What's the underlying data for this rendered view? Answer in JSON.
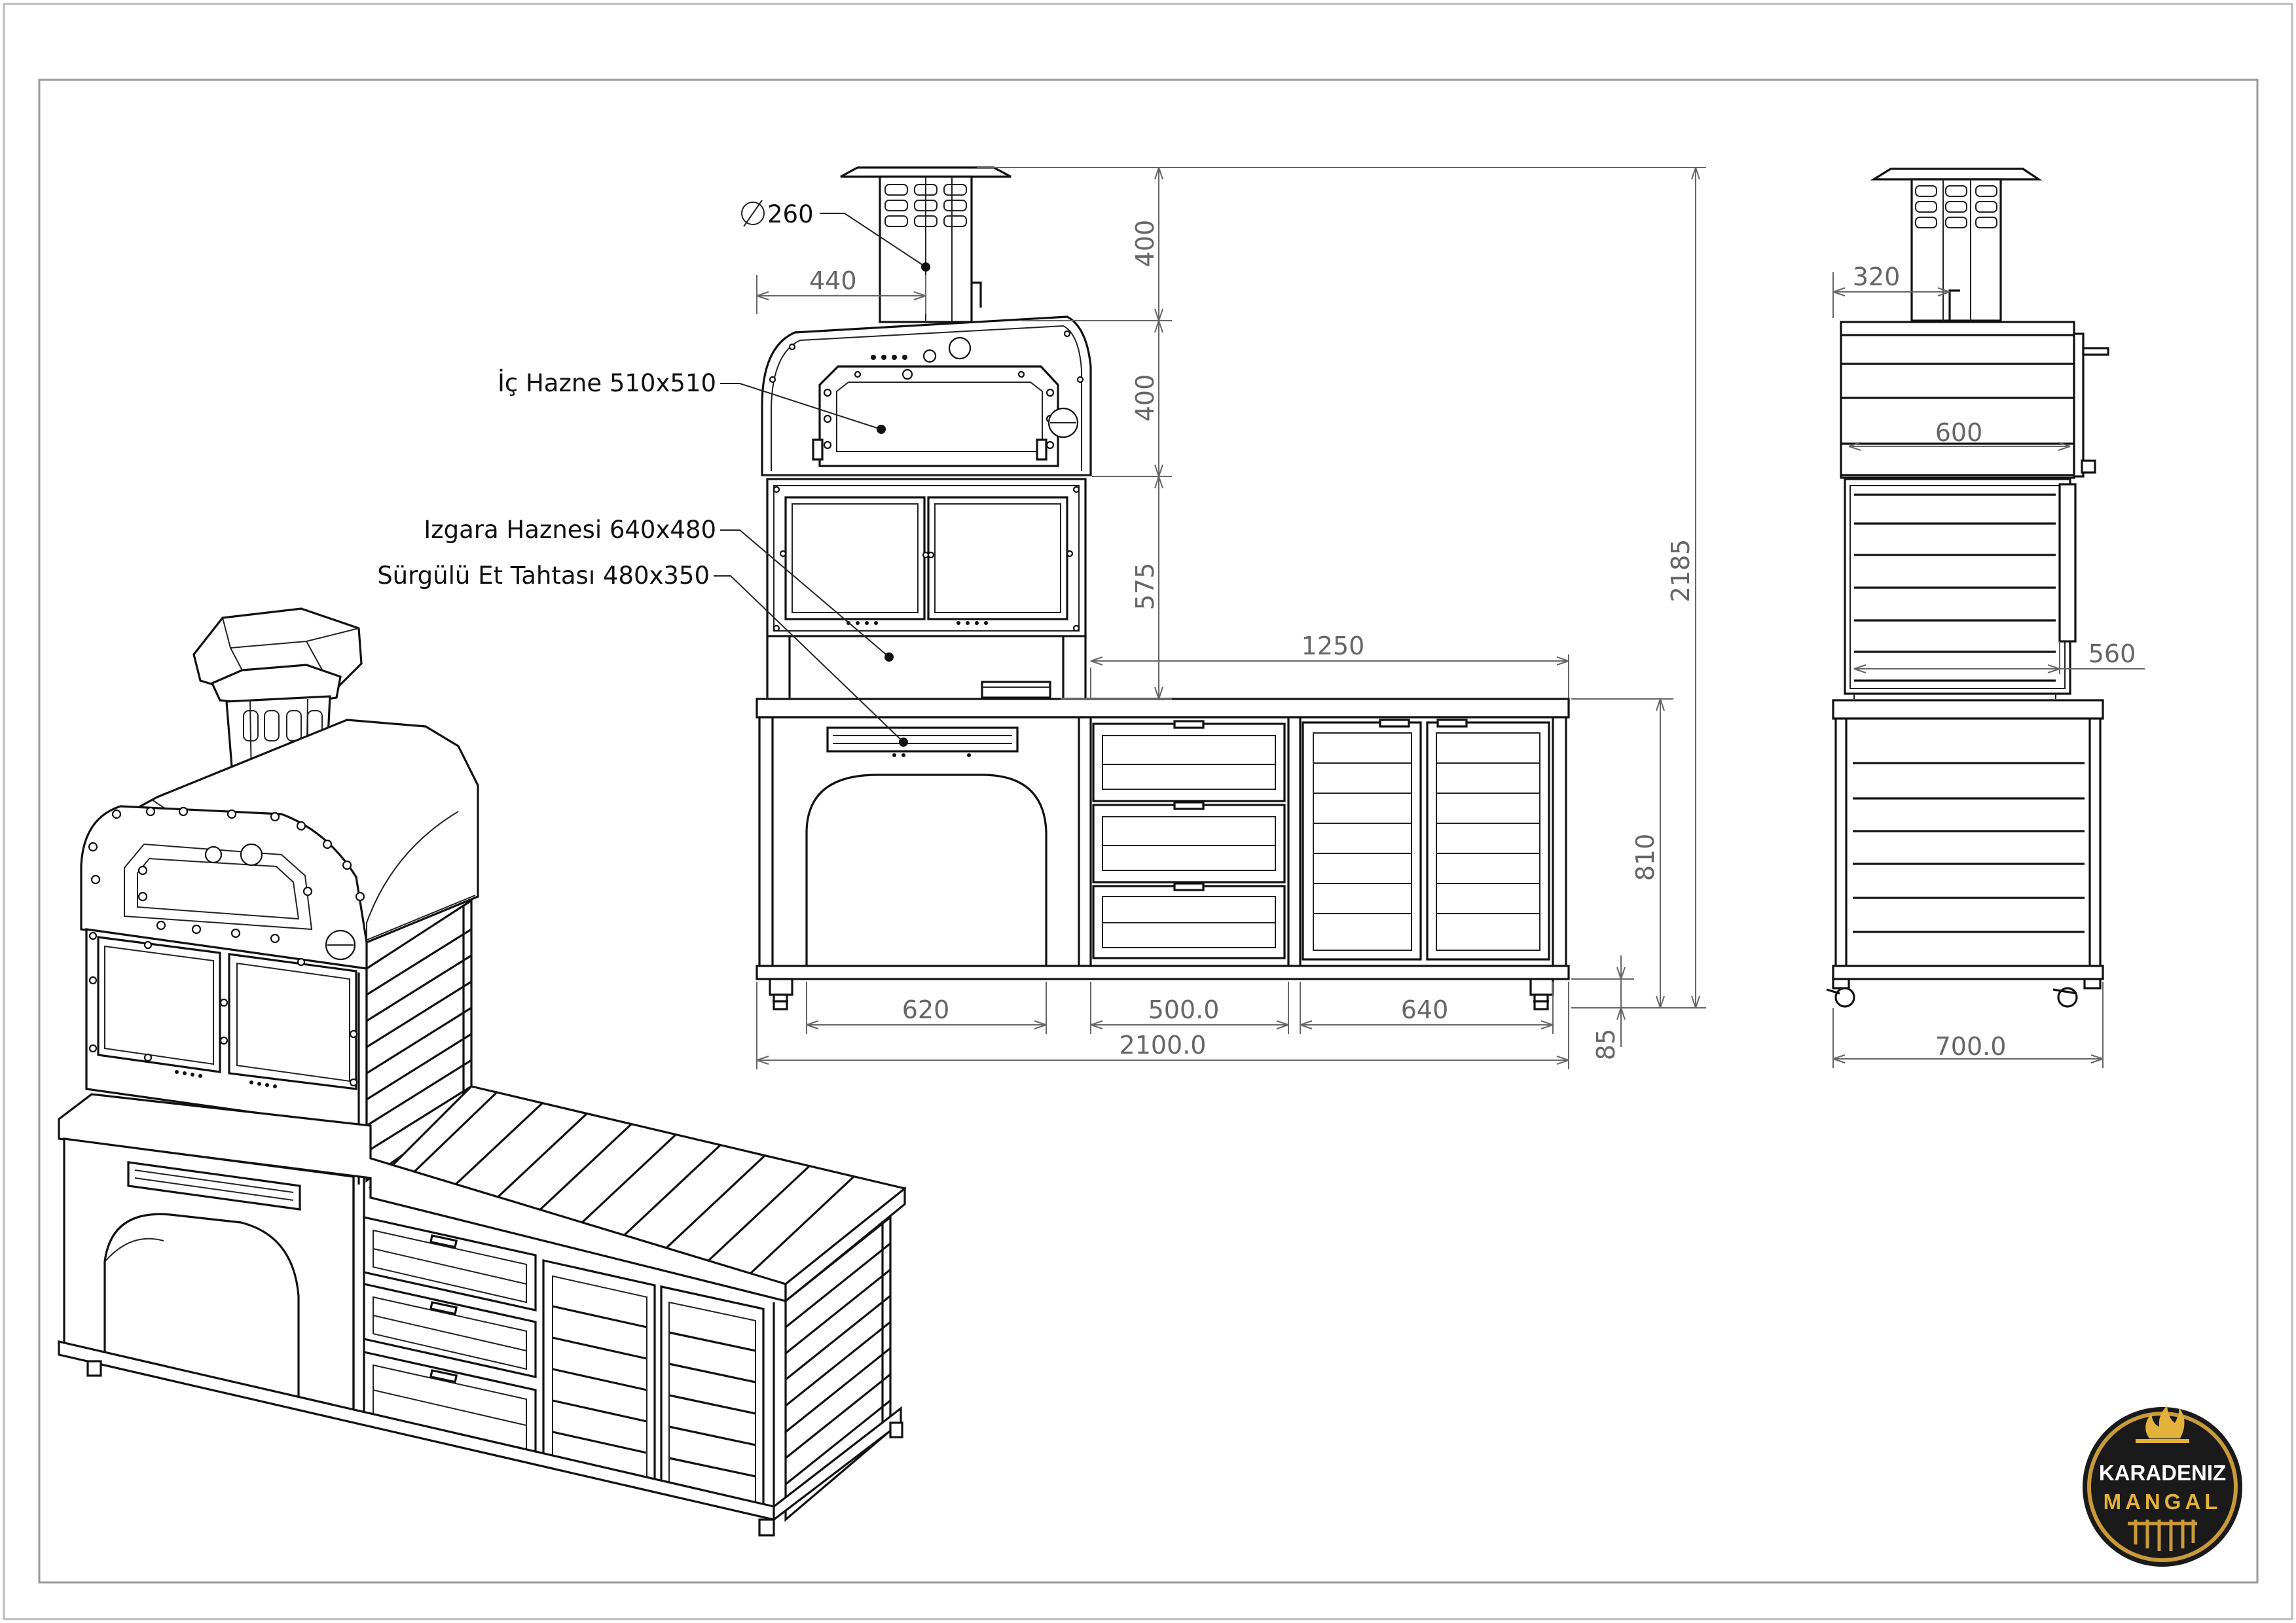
{
  "callouts": {
    "diameter": "260",
    "inner_chamber": "İç Hazne 510x510",
    "grill_chamber": "Izgara Haznesi 640x480",
    "cutting_board": "Sürgülü Et Tahtası 480x350"
  },
  "front_dimensions": {
    "chimney_offset": "440",
    "chimney_height": "400",
    "oven_height": "400",
    "grill_height": "575",
    "total_height": "2185",
    "counter_length": "1250",
    "cabinet_height": "810",
    "section_left": "620",
    "section_middle": "500.0",
    "section_right": "640",
    "total_width": "2100.0",
    "wheel_height": "85"
  },
  "side_dimensions": {
    "chimney_offset": "320",
    "oven_width": "600",
    "grill_depth": "560",
    "total_depth": "700.0"
  },
  "logo": {
    "line1": "KARADENIZ",
    "line2": "MANGAL",
    "ring_color": "#c99a3a",
    "flame_color": "#e3b23c",
    "bg_color": "#1a1a1a"
  }
}
